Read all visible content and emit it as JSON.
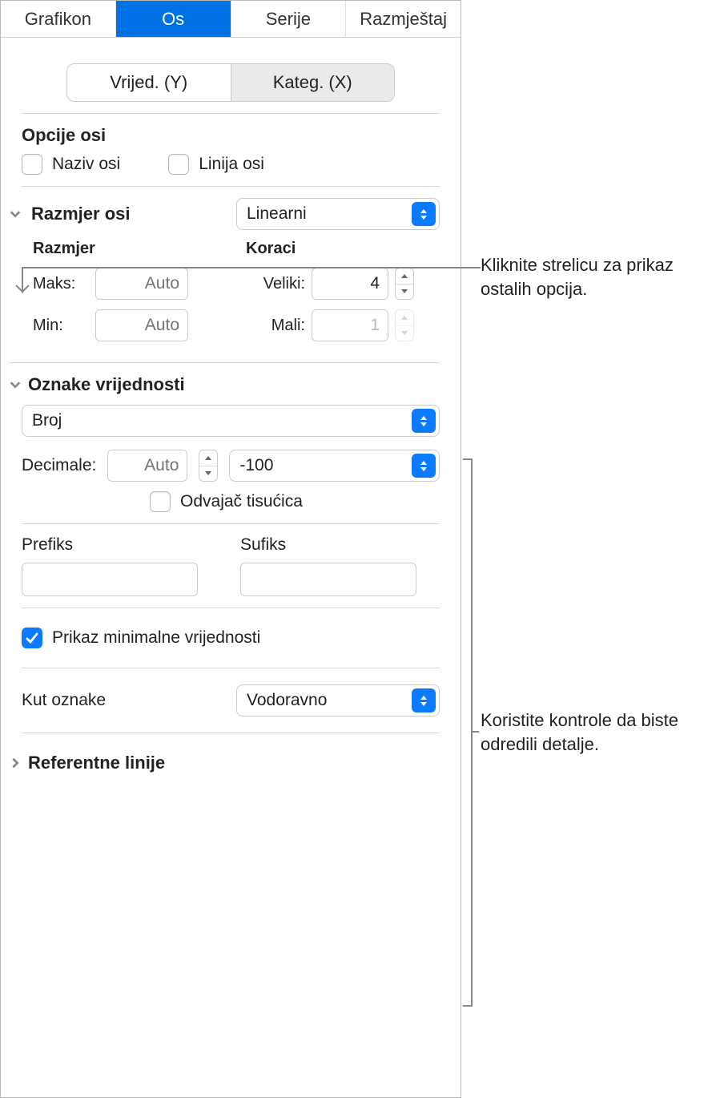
{
  "tabs": {
    "t0": "Grafikon",
    "t1": "Os",
    "t2": "Serije",
    "t3": "Razmještaj"
  },
  "seg": {
    "y": "Vrijed. (Y)",
    "x": "Kateg. (X)"
  },
  "axis_options": {
    "heading": "Opcije osi",
    "axis_name": "Naziv osi",
    "axis_line": "Linija osi"
  },
  "scale": {
    "heading": "Razmjer osi",
    "select_value": "Linearni",
    "scale_sub": "Razmjer",
    "steps_sub": "Koraci",
    "maks_label": "Maks:",
    "maks_placeholder": "Auto",
    "min_label": "Min:",
    "min_placeholder": "Auto",
    "big_label": "Veliki:",
    "big_value": "4",
    "small_label": "Mali:",
    "small_value": "1"
  },
  "value_labels": {
    "heading": "Oznake vrijednosti",
    "format_value": "Broj",
    "decimals_label": "Decimale:",
    "decimals_placeholder": "Auto",
    "neg_format": "-100",
    "thousands_sep": "Odvajač tisućica"
  },
  "prefix_suffix": {
    "prefix_label": "Prefiks",
    "suffix_label": "Sufiks"
  },
  "show_min": {
    "label": "Prikaz minimalne vrijednosti"
  },
  "angle": {
    "label": "Kut oznake",
    "value": "Vodoravno"
  },
  "ref_lines": {
    "heading": "Referentne linije"
  },
  "callouts": {
    "c1": "Kliknite strelicu za prikaz ostalih opcija.",
    "c2": "Koristite kontrole da biste odredili detalje."
  }
}
